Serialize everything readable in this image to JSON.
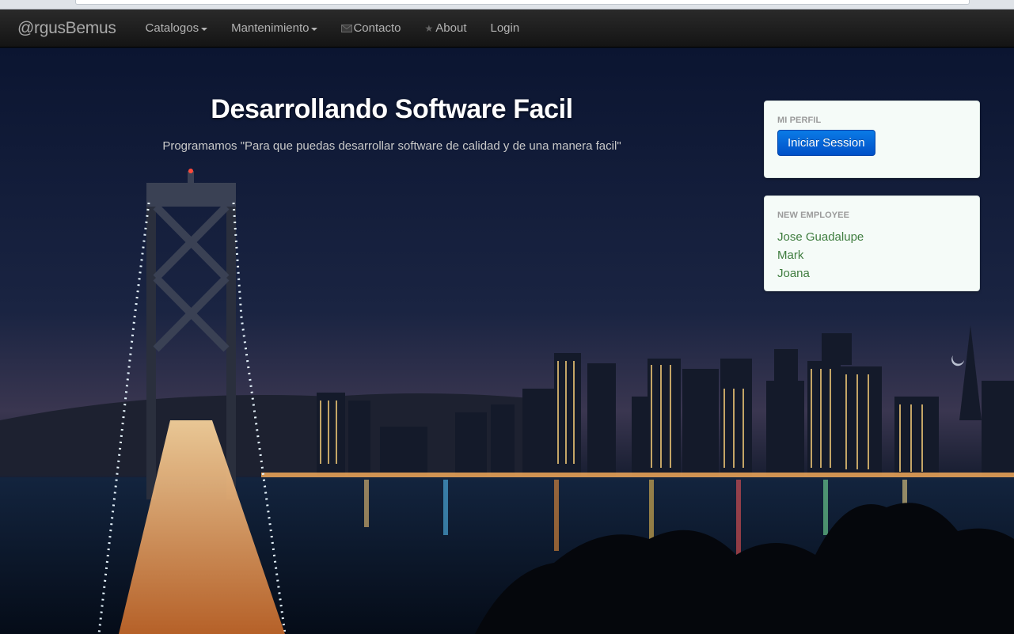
{
  "navbar": {
    "brand": "@rgusBemus",
    "items": [
      {
        "label": "Catalogos",
        "dropdown": true
      },
      {
        "label": "Mantenimiento",
        "dropdown": true
      },
      {
        "label": "Contacto",
        "icon": "envelope-icon"
      },
      {
        "label": "About",
        "icon": "star-icon"
      },
      {
        "label": "Login"
      }
    ]
  },
  "hero": {
    "title": "Desarrollando Software Facil",
    "subtitle": "Programamos \"Para que puedas desarrollar software de calidad y de una manera facil\""
  },
  "profile_panel": {
    "title": "MI PERFIL",
    "button_label": "Iniciar Session"
  },
  "employee_panel": {
    "title": "NEW EMPLOYEE",
    "employees": [
      "Jose Guadalupe",
      "Mark",
      "Joana"
    ]
  },
  "colors": {
    "navbar_bg": "#1b1b1b",
    "button_blue": "#0066dd",
    "employee_link": "#3f7d3f",
    "panel_bg": "#f5fbf8"
  }
}
